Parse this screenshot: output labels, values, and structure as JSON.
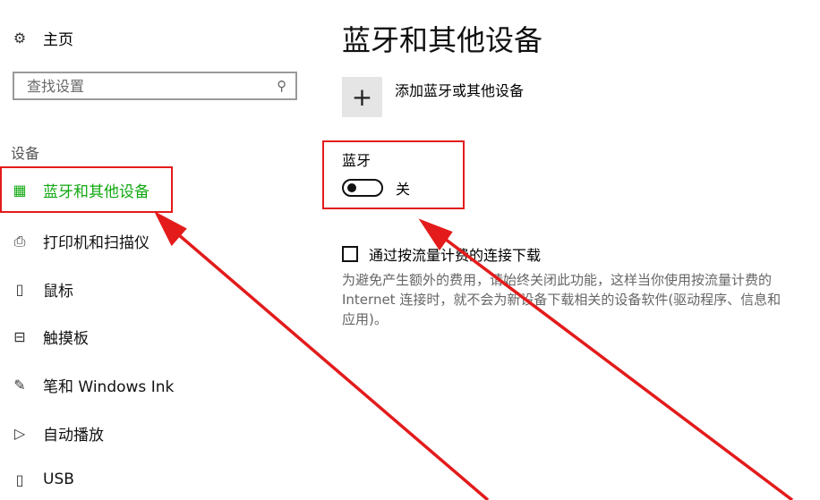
{
  "sidebar": {
    "home": {
      "icon": "gear-icon",
      "label": "主页"
    },
    "search": {
      "placeholder": "查找设置",
      "icon": "search-icon"
    },
    "section_title": "设备",
    "items": [
      {
        "id": "bluetooth",
        "icon": "bluetooth-devices-icon",
        "label": "蓝牙和其他设备",
        "active": true
      },
      {
        "id": "printers",
        "icon": "printer-icon",
        "label": "打印机和扫描仪"
      },
      {
        "id": "mouse",
        "icon": "mouse-icon",
        "label": "鼠标"
      },
      {
        "id": "touchpad",
        "icon": "touchpad-icon",
        "label": "触摸板"
      },
      {
        "id": "pen",
        "icon": "pen-icon",
        "label": "笔和 Windows Ink"
      },
      {
        "id": "autoplay",
        "icon": "autoplay-icon",
        "label": "自动播放"
      },
      {
        "id": "usb",
        "icon": "usb-icon",
        "label": "USB"
      }
    ]
  },
  "main": {
    "title": "蓝牙和其他设备",
    "add_device": {
      "icon": "plus-icon",
      "label": "添加蓝牙或其他设备"
    },
    "bluetooth": {
      "label": "蓝牙",
      "state_label": "关",
      "on": false
    },
    "metered": {
      "label": "通过按流量计费的连接下载",
      "checked": false,
      "description": "为避免产生额外的费用，请始终关闭此功能，这样当你使用按流量计费的 Internet 连接时，就不会为新设备下载相关的设备软件(驱动程序、信息和应用)。"
    }
  },
  "annotations": {
    "highlight_color": "#e31b1b",
    "accent_color": "#11a811"
  }
}
